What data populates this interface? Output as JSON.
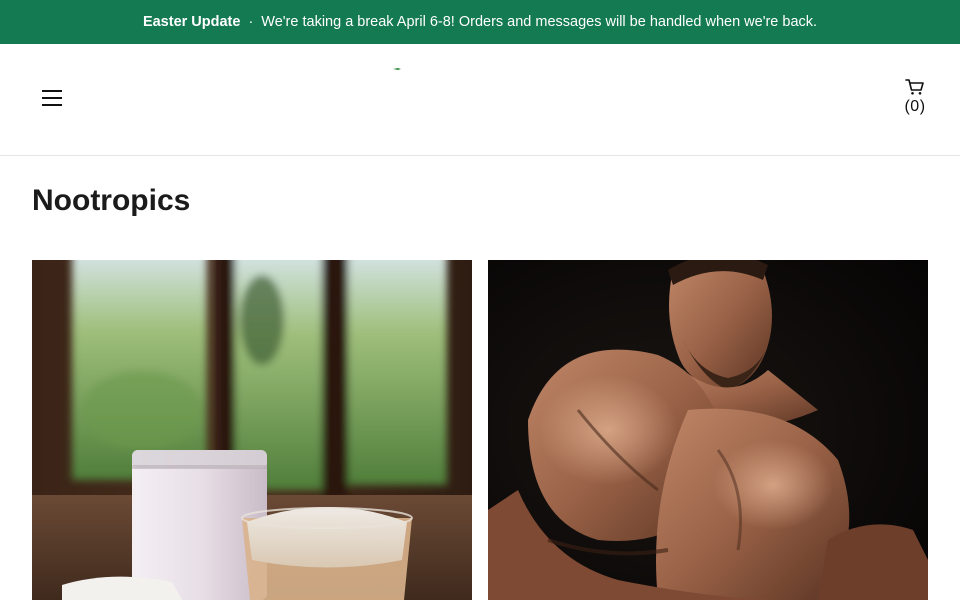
{
  "announcement": {
    "title": "Easter Update",
    "separator": "·",
    "message": "We're taking a break April 6-8! Orders and messages will be handled when we're back."
  },
  "header": {
    "menu_icon": "hamburger-menu-icon",
    "cart_icon": "shopping-cart-icon",
    "cart_count": "(0)"
  },
  "collection": {
    "title": "Nootropics"
  },
  "colors": {
    "announcement_bg": "#137a52",
    "title_text": "#1b1b1b"
  }
}
